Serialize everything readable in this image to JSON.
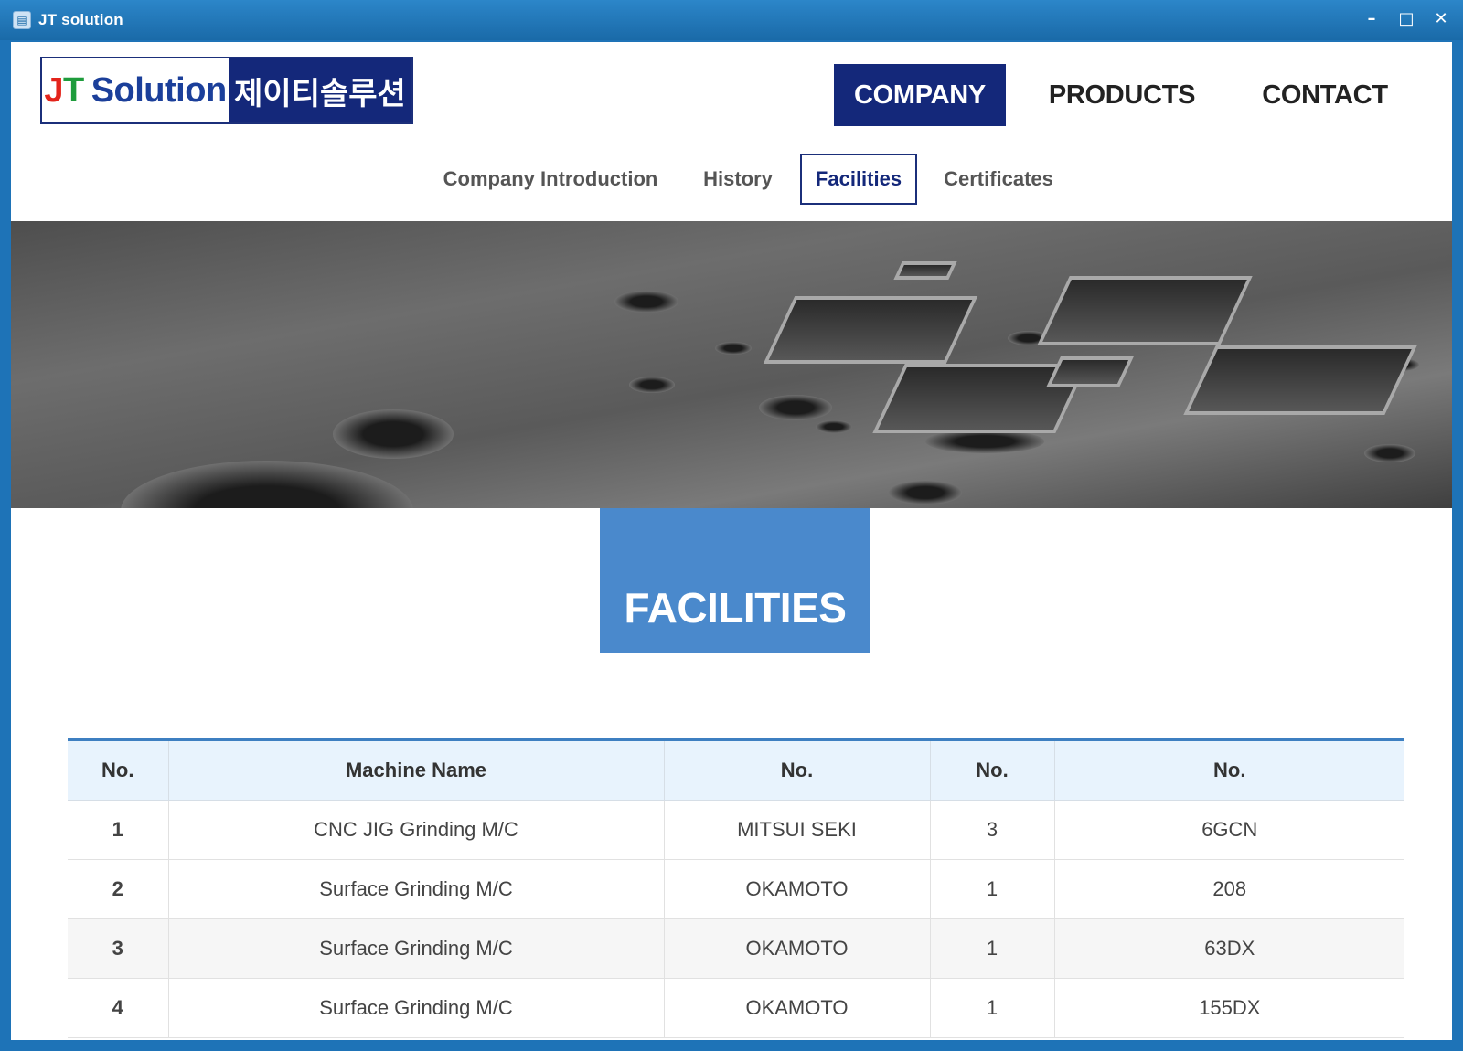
{
  "window": {
    "title": "JT solution",
    "controls": {
      "minimize": "–",
      "maximize": "□",
      "close": "✕"
    }
  },
  "logo": {
    "j": "J",
    "t": "T",
    "solution": "Solution",
    "korean": "제이티솔루션"
  },
  "main_nav": {
    "company": "COMPANY",
    "products": "PRODUCTS",
    "contact": "CONTACT"
  },
  "sub_nav": {
    "introduction": "Company Introduction",
    "history": "History",
    "facilities": "Facilities",
    "certificates": "Certificates"
  },
  "section": {
    "title": "FACILITIES"
  },
  "table": {
    "headers": [
      "No.",
      "Machine Name",
      "No.",
      "No.",
      "No."
    ],
    "rows": [
      [
        "1",
        "CNC JIG Grinding M/C",
        "MITSUI SEKI",
        "3",
        "6GCN"
      ],
      [
        "2",
        "Surface Grinding M/C",
        "OKAMOTO",
        "1",
        "208"
      ],
      [
        "3",
        "Surface Grinding M/C",
        "OKAMOTO",
        "1",
        "63DX"
      ],
      [
        "4",
        "Surface Grinding M/C",
        "OKAMOTO",
        "1",
        "155DX"
      ]
    ]
  },
  "colors": {
    "navy": "#14287a",
    "accent_blue": "#4a89cc",
    "frame": "#1e73b7",
    "table_header": "#e8f3fd"
  }
}
